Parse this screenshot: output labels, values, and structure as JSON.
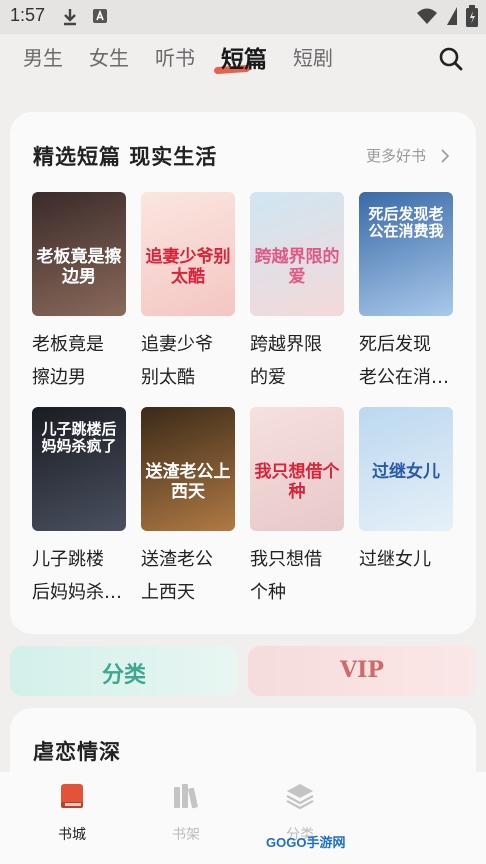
{
  "status_bar": {
    "time": "1:57"
  },
  "nav": {
    "tabs": [
      {
        "label": "男生"
      },
      {
        "label": "女生"
      },
      {
        "label": "听书"
      },
      {
        "label": "短篇"
      },
      {
        "label": "短剧"
      }
    ],
    "active_tab": "短篇",
    "accent_color": "#e2533a"
  },
  "section": {
    "title": "精选短篇 现实生活",
    "more_label": "更多好书",
    "books": [
      {
        "title_line1": "老板竟是",
        "title_line2": "擦边男",
        "cover_text": "老板竟是擦边男",
        "cover_colors": [
          "#3a2a2a",
          "#8a6a5a"
        ],
        "cover_text_color": "#ffffff"
      },
      {
        "title_line1": "追妻少爷",
        "title_line2": "别太酷",
        "cover_text": "追妻少爷别太酷",
        "cover_colors": [
          "#fbe6e0",
          "#f4c6c2"
        ],
        "cover_text_color": "#d8243a"
      },
      {
        "title_line1": "跨越界限",
        "title_line2": "的爱",
        "cover_text": "跨越界限的爱",
        "cover_colors": [
          "#cfe6f2",
          "#f3d9d9"
        ],
        "cover_text_color": "#e05a88"
      },
      {
        "title_line1": "死后发现",
        "title_line2": "老公在消…",
        "cover_text": "死后发现老公在消费我",
        "cover_colors": [
          "#3a6aa8",
          "#a9c9ea"
        ],
        "cover_text_color": "#ffffff"
      },
      {
        "title_line1": "儿子跳楼",
        "title_line2": "后妈妈杀…",
        "cover_text": "儿子跳楼后妈妈杀疯了",
        "cover_colors": [
          "#1a1c22",
          "#4a5060"
        ],
        "cover_text_color": "#ffffff"
      },
      {
        "title_line1": "送渣老公",
        "title_line2": "上西天",
        "cover_text": "送渣老公上西天",
        "cover_colors": [
          "#3a2a18",
          "#b07a44"
        ],
        "cover_text_color": "#ffffff"
      },
      {
        "title_line1": "我只想借",
        "title_line2": "个种",
        "cover_text": "我只想借个种",
        "cover_colors": [
          "#f6e0e0",
          "#e8c8c8"
        ],
        "cover_text_color": "#d8243a"
      },
      {
        "title_line1": "过继女儿",
        "title_line2": "",
        "cover_text": "过继女儿",
        "cover_colors": [
          "#bcd8ef",
          "#e6f0f8"
        ],
        "cover_text_color": "#2a5aa8"
      }
    ]
  },
  "buttons": {
    "category_label": "分类",
    "category_color": "#3fa78f",
    "vip_label": "VIP",
    "vip_color": "#d06a6a"
  },
  "section2": {
    "title": "虐恋情深"
  },
  "bottom_nav": {
    "items": [
      {
        "label": "书城",
        "icon": "book-icon",
        "active": true
      },
      {
        "label": "书架",
        "icon": "bookshelf-icon",
        "active": false
      },
      {
        "label": "分类",
        "icon": "layers-icon",
        "active": false
      }
    ],
    "active_color": "#e2533a"
  },
  "watermark": "GOGO手游网"
}
